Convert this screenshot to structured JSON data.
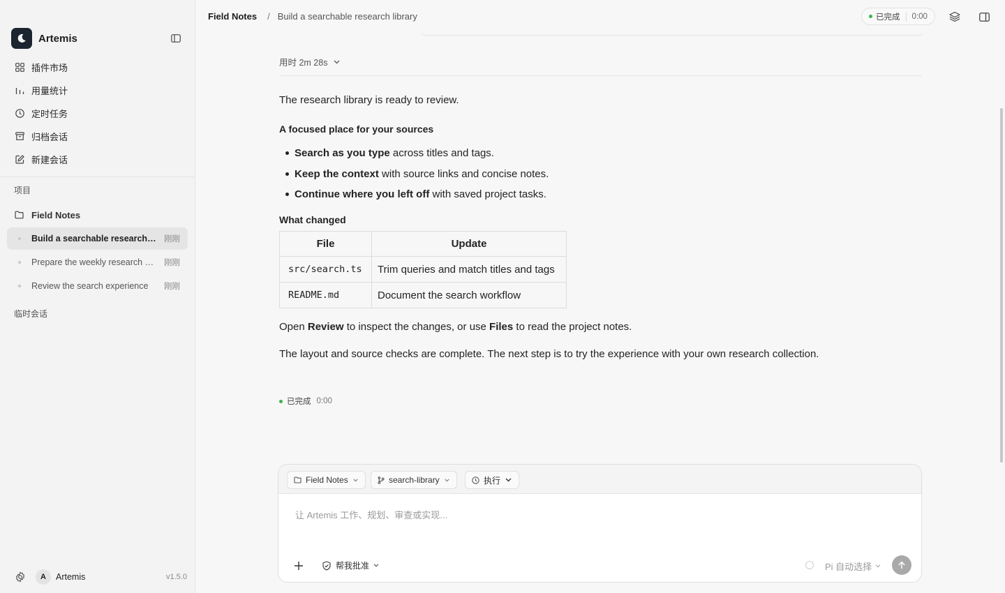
{
  "app": {
    "name": "Artemis",
    "version": "v1.5.0"
  },
  "sidebar": {
    "nav": [
      {
        "label": "插件市场",
        "icon": "grid-icon"
      },
      {
        "label": "用量统计",
        "icon": "bar-chart-icon"
      },
      {
        "label": "定时任务",
        "icon": "clock-icon"
      },
      {
        "label": "归档会话",
        "icon": "archive-icon"
      },
      {
        "label": "新建会话",
        "icon": "edit-icon"
      }
    ],
    "projects_label": "项目",
    "project": {
      "name": "Field Notes",
      "icon": "folder-icon"
    },
    "sessions": [
      {
        "title": "Build a searchable research library",
        "time": "刚刚",
        "active": true
      },
      {
        "title": "Prepare the weekly research brief",
        "time": "刚刚",
        "active": false
      },
      {
        "title": "Review the search experience",
        "time": "刚刚",
        "active": false
      }
    ],
    "temp_label": "临时会话",
    "user": {
      "initial": "A",
      "name": "Artemis"
    }
  },
  "topbar": {
    "project": "Field Notes",
    "separator": "/",
    "title": "Build a searchable research library",
    "status": "已完成",
    "timer": "0:00"
  },
  "message": {
    "duration": "用时 2m 28s",
    "intro": "The research library is ready to review.",
    "heading1": "A focused place for your sources",
    "bullets": [
      {
        "bold": "Search as you type",
        "rest": " across titles and tags."
      },
      {
        "bold": "Keep the context",
        "rest": " with source links and concise notes."
      },
      {
        "bold": "Continue where you left off",
        "rest": " with saved project tasks."
      }
    ],
    "heading2": "What changed",
    "table": {
      "headers": [
        "File",
        "Update"
      ],
      "rows": [
        [
          "src/search.ts",
          "Trim queries and match titles and tags"
        ],
        [
          "README.md",
          "Document the search workflow"
        ]
      ]
    },
    "open_text": {
      "a": "Open ",
      "b1": "Review",
      "c": " to inspect the changes, or use ",
      "b2": "Files",
      "d": " to read the project notes."
    },
    "closing": "The layout and source checks are complete. The next step is to try the experience with your own research collection.",
    "status": "已完成",
    "timer": "0:00"
  },
  "composer": {
    "chips": {
      "project": "Field Notes",
      "branch": "search-library",
      "mode": "执行"
    },
    "placeholder": "让 Artemis 工作、规划、审查或实现...",
    "approve": "帮我批准",
    "model": "Pi 自动选择"
  }
}
